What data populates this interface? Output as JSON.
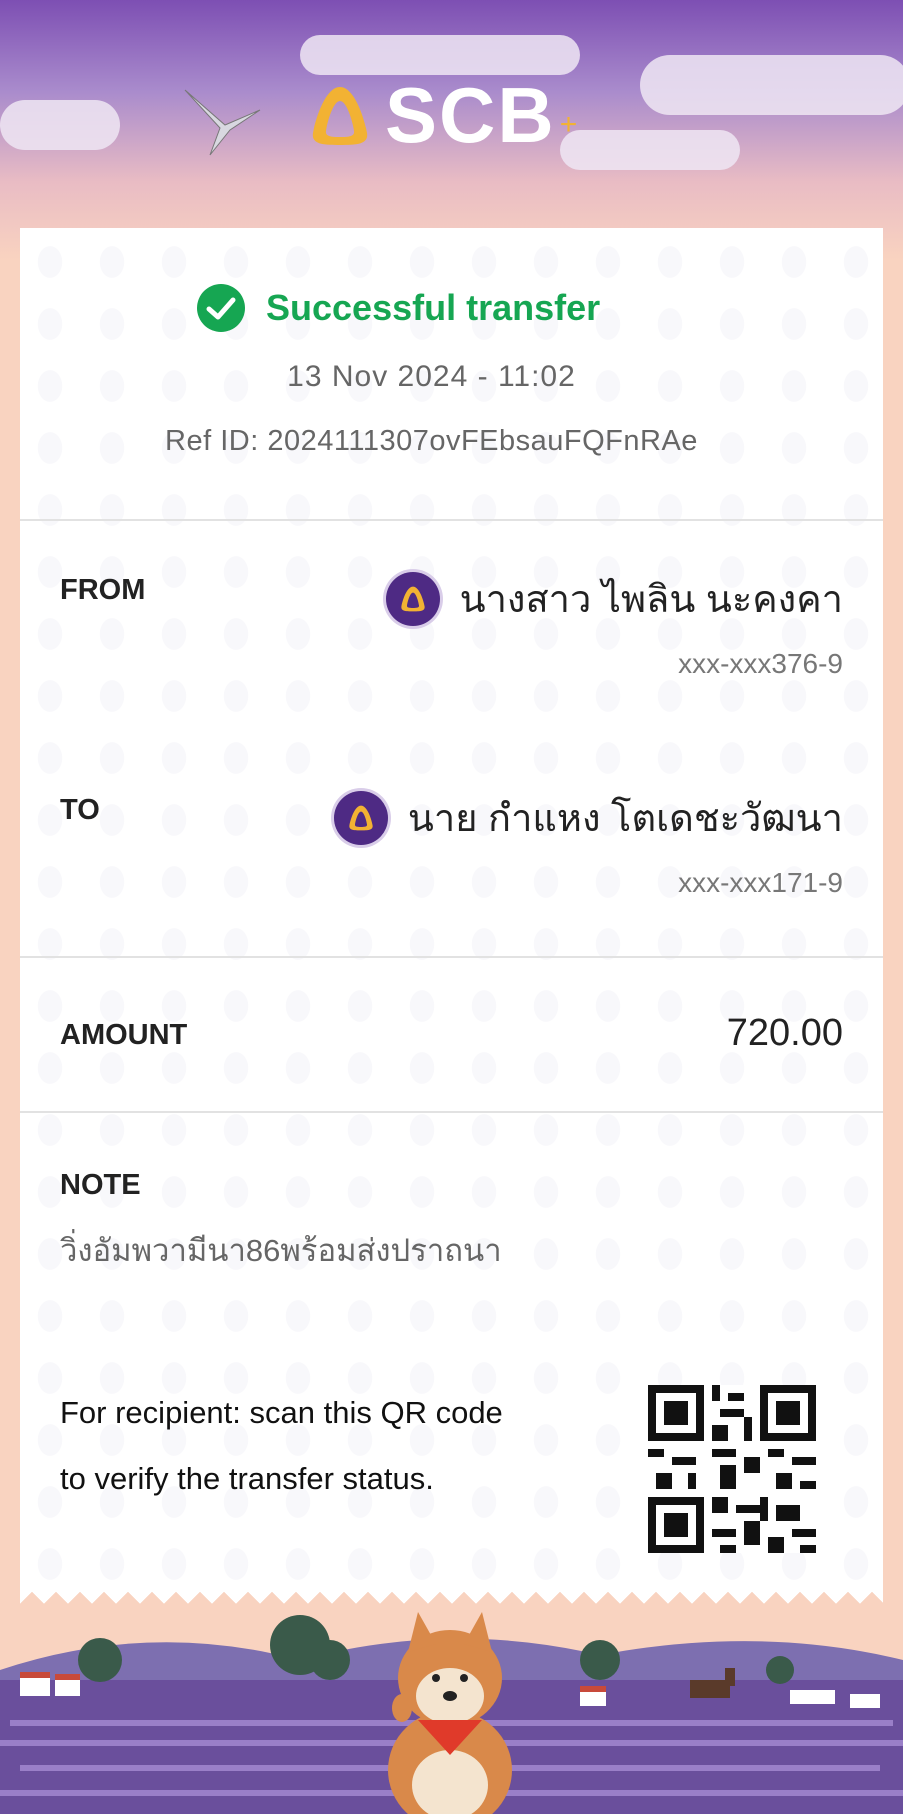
{
  "brand": {
    "logo_text": "SCB",
    "accent": "#f2b233",
    "purple": "#4e2a84"
  },
  "status": {
    "text": "Successful transfer",
    "color": "#16a652"
  },
  "date": "13 Nov 2024 - 11:02",
  "ref": "Ref ID: 2024111307ovFEbsauFQFnRAe",
  "from": {
    "label": "FROM",
    "name": "นางสาว ไพลิน นะคงคา",
    "account": "xxx-xxx376-9"
  },
  "to": {
    "label": "TO",
    "name": "นาย กำแหง โตเดชะวัฒนา",
    "account": "xxx-xxx171-9"
  },
  "amount": {
    "label": "AMOUNT",
    "value": "720.00"
  },
  "note": {
    "label": "NOTE",
    "text": "วิ่งอัมพวามีนา86พร้อมส่งปราถนา"
  },
  "recipient_text": "For recipient: scan this QR code to verify the transfer status."
}
